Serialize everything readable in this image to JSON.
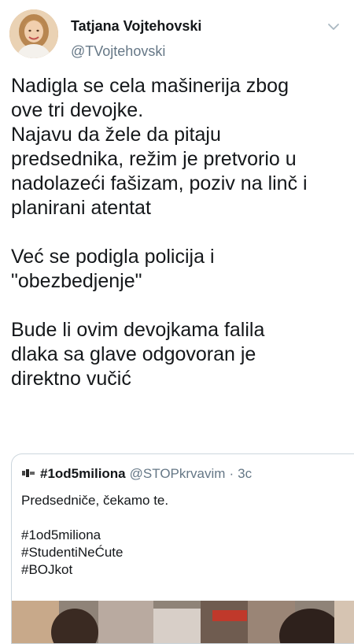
{
  "author": {
    "name": "Tatjana Vojtehovski",
    "handle": "@TVojtehovski",
    "avatar_icon": "profile-photo",
    "menu_icon": "chevron-down-icon"
  },
  "tweet": {
    "paragraphs": [
      [
        "Nadigla se cela mašinerija zbog",
        "ove tri devojke.",
        "Najavu da žele da pitaju",
        "predsednika, režim  je pretvorio u",
        "nadolazeći fašizam, poziv na linč i",
        "planirani atentat"
      ],
      [
        "Već se podigla policija i",
        "\"obezbedjenje\""
      ],
      [
        "Bude li ovim devojkama falila",
        "dlaka sa glave odgovoran je",
        "direktno vučić"
      ]
    ]
  },
  "quoted_tweet": {
    "name": "#1od5miliona",
    "handle": "@STOPkrvavim",
    "separator": "·",
    "time": "3c",
    "lines": [
      "Predsedniče, čekamo te.",
      "",
      "#1od5miliona",
      "#StudentiNeĆute",
      "#BOJkot"
    ]
  },
  "colors": {
    "text": "#14171a",
    "secondary": "#657786",
    "border": "#ccd6dd"
  }
}
